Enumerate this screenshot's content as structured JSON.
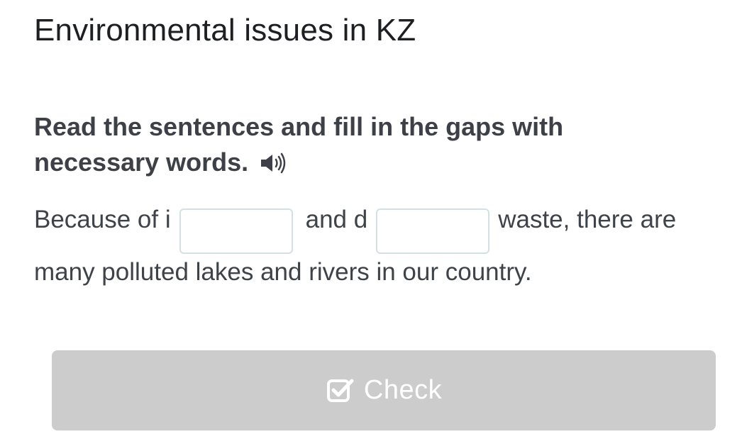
{
  "page": {
    "title": "Environmental issues in KZ"
  },
  "task": {
    "instruction": "Read the sentences and fill in the gaps with necessary words.",
    "audio_icon": "speaker-icon"
  },
  "sentence": {
    "part1": "Because of i",
    "gap1_value": "",
    "part2": "and d",
    "gap2_value": "",
    "part3": "waste, there are many polluted lakes and rivers in our country."
  },
  "check_button": {
    "label": "Check",
    "icon": "checkbox-icon",
    "state": "disabled"
  },
  "colors": {
    "button_bg": "#cccccc",
    "input_border": "#d3e1e4",
    "text": "#3e4349"
  }
}
